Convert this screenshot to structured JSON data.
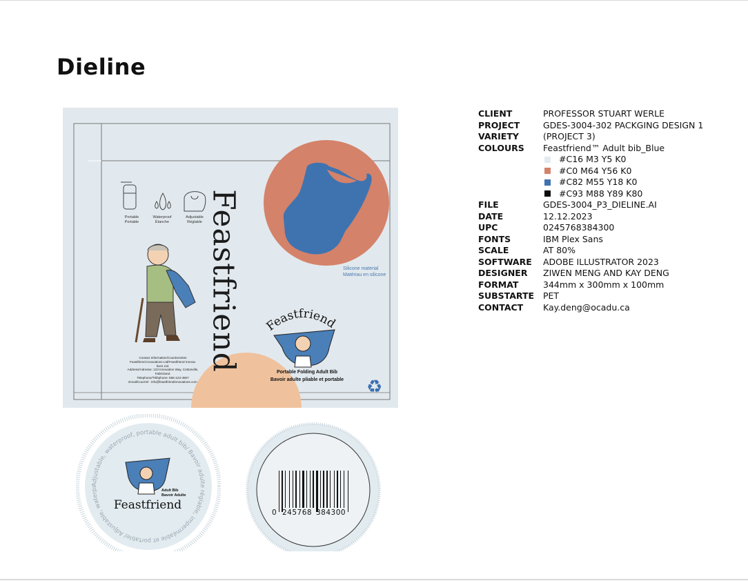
{
  "page": {
    "title": "Dieline"
  },
  "specs": [
    {
      "key": "CLIENT",
      "value": "PROFESSOR STUART WERLE"
    },
    {
      "key": "PROJECT",
      "value": "GDES-3004-302 PACKGING DESIGN 1"
    },
    {
      "key": "VARIETY",
      "value": "(PROJECT 3)"
    },
    {
      "key": "COLOURS",
      "value": "Feastfriend™ Adult bib_Blue"
    }
  ],
  "colours": [
    {
      "label": "#C16 M3 Y5 K0",
      "hex": "#e2ebf0"
    },
    {
      "label": "#C0 M64 Y56 K0",
      "hex": "#d4826a"
    },
    {
      "label": "#C82 M55 Y18 K0",
      "hex": "#3f73b0"
    },
    {
      "label": "#C93 M88 Y89 K80",
      "hex": "#0c0c0c"
    }
  ],
  "specs2": [
    {
      "key": "FILE",
      "value": "GDES-3004_P3_DIELINE.AI"
    },
    {
      "key": "DATE",
      "value": "12.12.2023"
    },
    {
      "key": "UPC",
      "value": "0245768384300"
    },
    {
      "key": "FONTS",
      "value": "IBM Plex Sans"
    },
    {
      "key": "SCALE",
      "value": "AT 80%"
    },
    {
      "key": "SOFTWARE",
      "value": "ADOBE ILLUSTRATOR 2023"
    },
    {
      "key": "DESIGNER",
      "value": "ZIWEN MENG AND KAY DENG"
    },
    {
      "key": "FORMAT",
      "value": "344mm x 300mm x 100mm"
    },
    {
      "key": "SUBSTARTE",
      "value": "PET"
    },
    {
      "key": "CONTACT",
      "value": "Kay.deng@ocadu.ca"
    }
  ],
  "dieline": {
    "brand": "Feastfriend",
    "icons": [
      {
        "label": "Portable\nPortable"
      },
      {
        "label": "Waterproof\nÉtanche"
      },
      {
        "label": "Adjustable\nRéglable"
      }
    ],
    "silicone": "Silicone material\nMatériau en silicone",
    "contact": "Contact Information/Coordonnées\nFeastfriend Innovations Ltd/Feastfriend Innova-\ntions Ltd.\nAddress/Adresse: 123 Innovation Way, Cottonville,\nFabricland.\nTelephone/Téléphone: 555-123-4567\nEmail/Courriel : info@feastfriendinnovations.com",
    "product_en": "Portable Folding Adult Bib",
    "product_fr": "Bavoir adulte pliable et portable",
    "recycle_icon": "recycle-icon"
  },
  "lid": {
    "ring_text": "Adjustable, waterproof, portable adult bib/ Bavoir adulte réglable, imperméable et portable/ Adjustable, waterproof, portable adult",
    "small_en": "Adult Bib",
    "small_fr": "Bavoir Adulte",
    "brand": "Feastfriend"
  },
  "barcode": {
    "first": "0",
    "left": "245768",
    "right": "384300"
  }
}
